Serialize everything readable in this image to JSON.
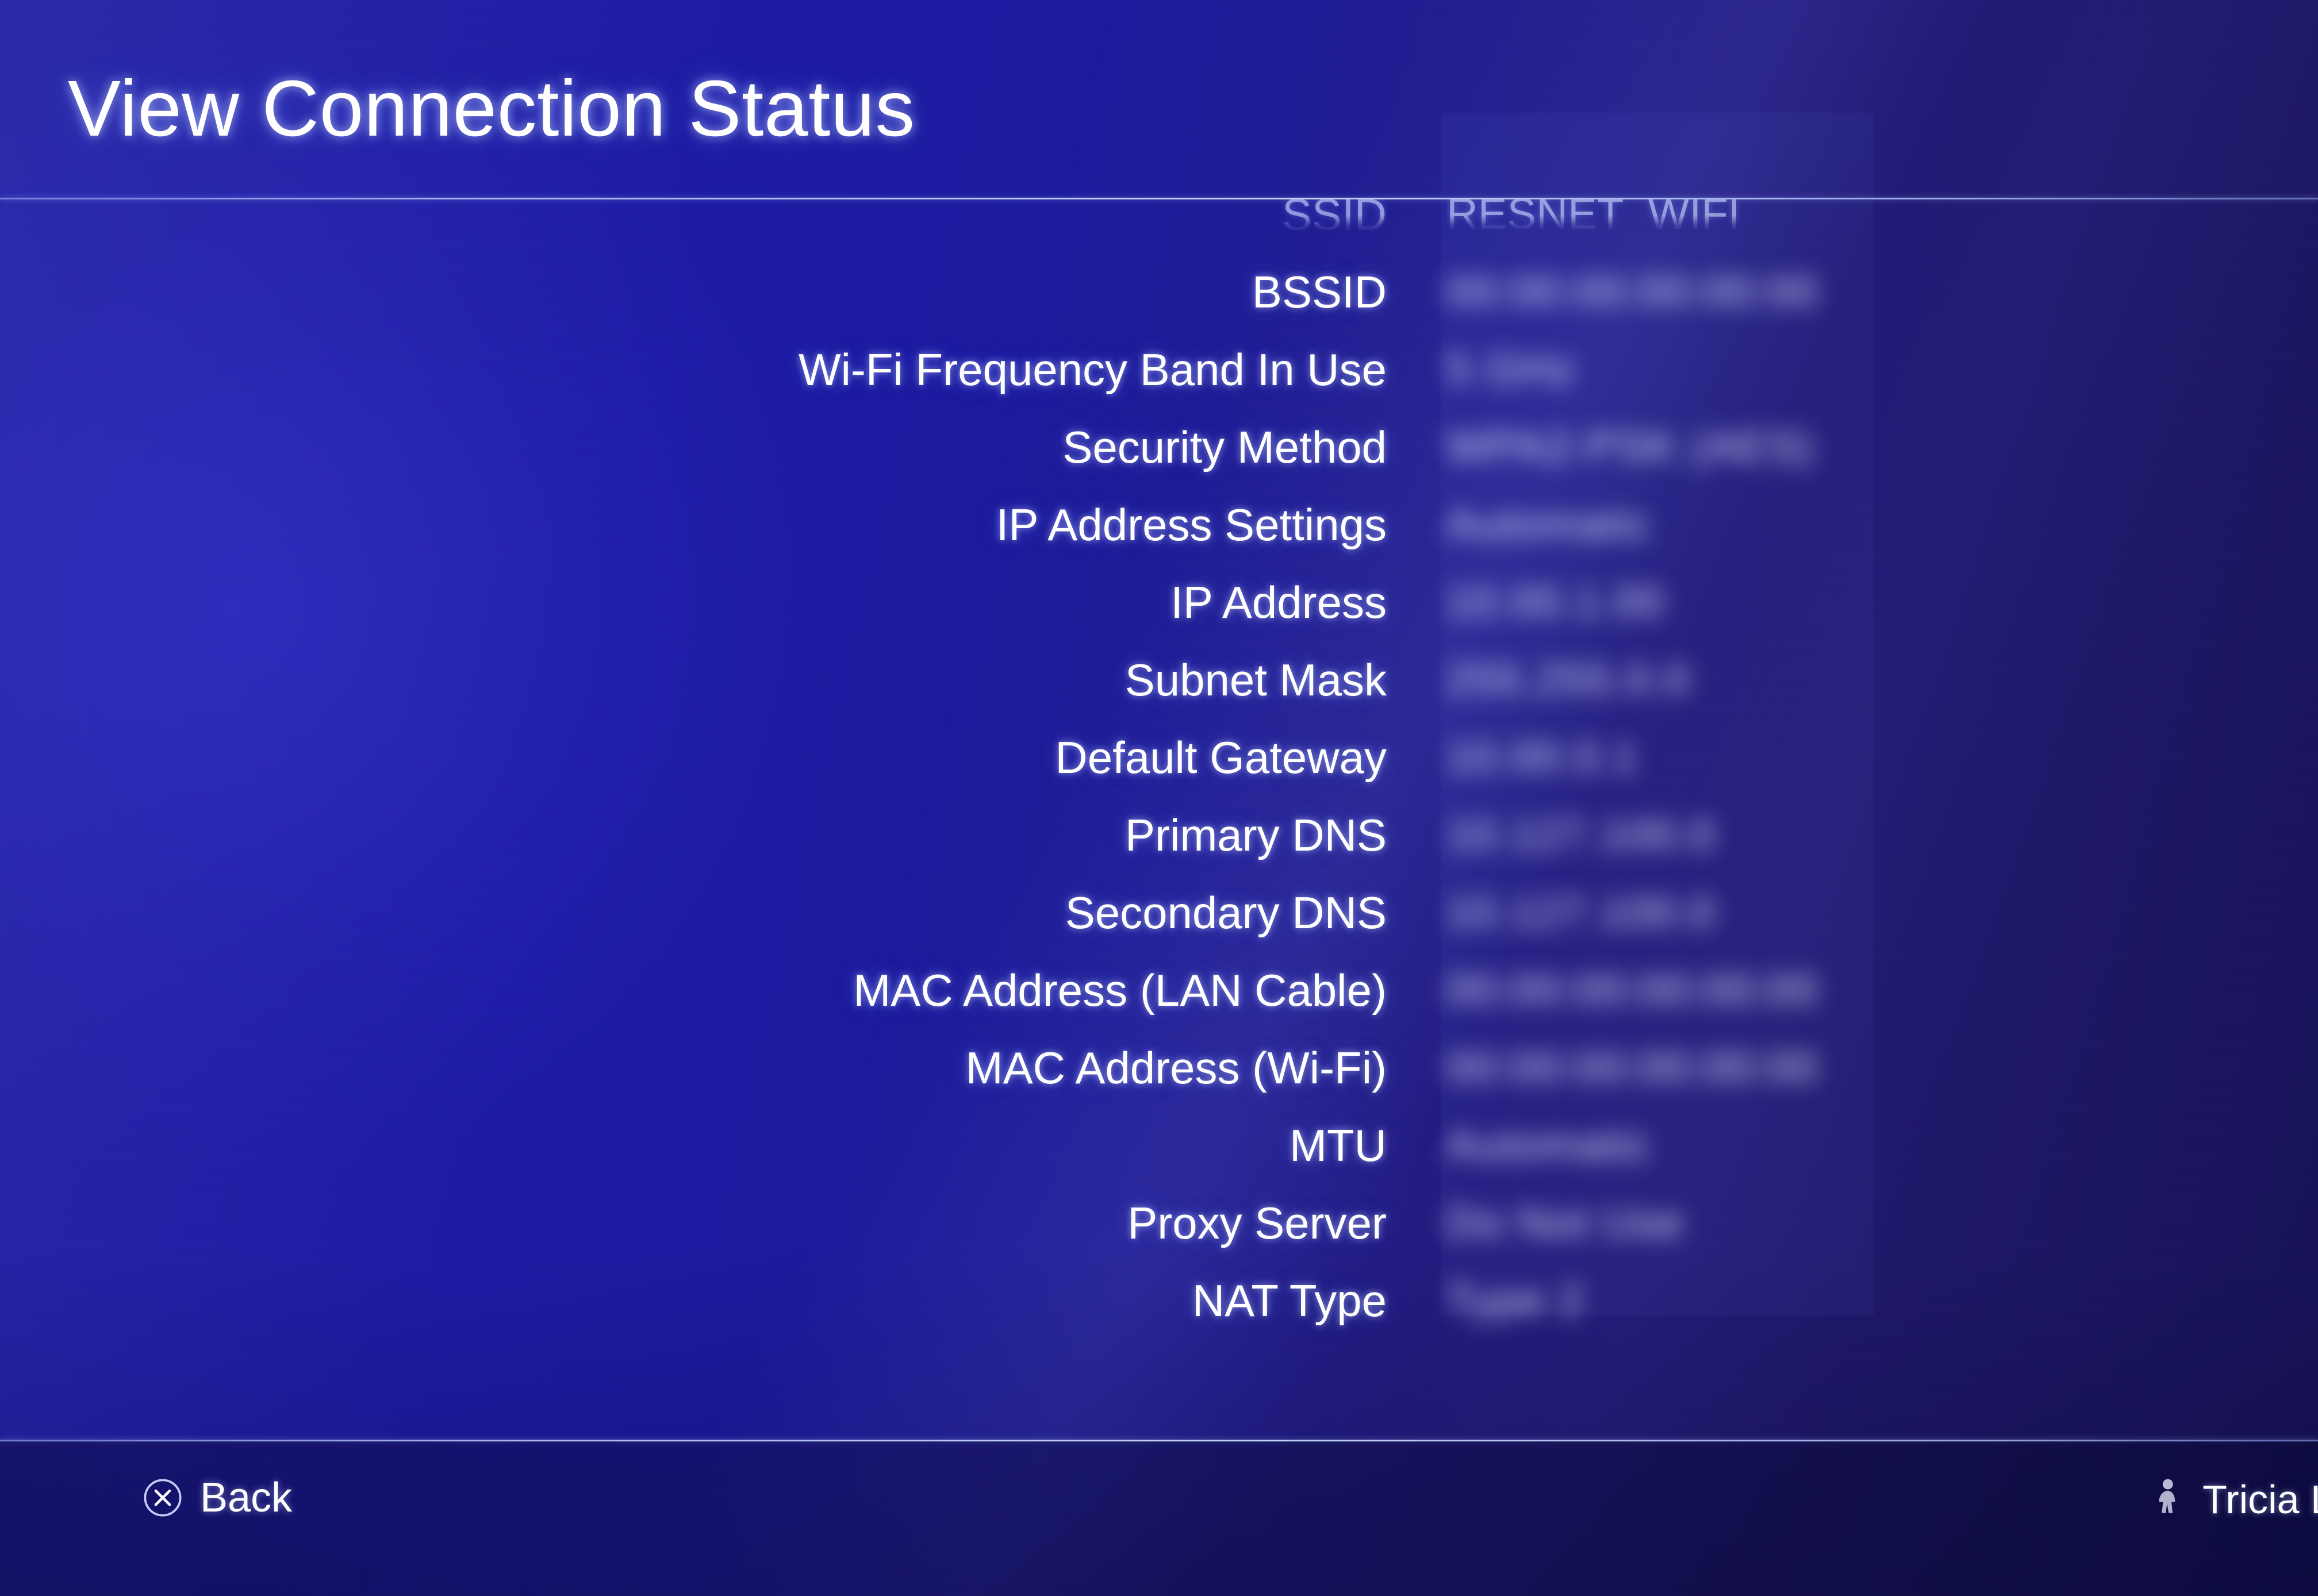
{
  "header": {
    "title": "View Connection Status"
  },
  "connection": {
    "rows": [
      {
        "label": "SSID",
        "value": "RESNET_WIFI",
        "redacted": false,
        "clipped": true
      },
      {
        "label": "BSSID",
        "value": "00:00:00:00:00:00",
        "redacted": true,
        "clipped": false
      },
      {
        "label": "Wi-Fi Frequency Band In Use",
        "value": "5 GHz",
        "redacted": true,
        "clipped": false
      },
      {
        "label": "Security Method",
        "value": "WPA2-PSK (AES)",
        "redacted": true,
        "clipped": false
      },
      {
        "label": "IP Address Settings",
        "value": "Automatic",
        "redacted": true,
        "clipped": false
      },
      {
        "label": "IP Address",
        "value": "10.00.1.00",
        "redacted": true,
        "clipped": false
      },
      {
        "label": "Subnet Mask",
        "value": "255.255.0.0",
        "redacted": true,
        "clipped": false
      },
      {
        "label": "Default Gateway",
        "value": "10.00.0.1",
        "redacted": true,
        "clipped": false
      },
      {
        "label": "Primary DNS",
        "value": "10.127.100.0",
        "redacted": true,
        "clipped": false
      },
      {
        "label": "Secondary DNS",
        "value": "10.127.100.0",
        "redacted": true,
        "clipped": false
      },
      {
        "label": "MAC Address (LAN Cable)",
        "value": "00:00:00:00:00:00",
        "redacted": true,
        "clipped": false
      },
      {
        "label": "MAC Address (Wi-Fi)",
        "value": "00:00:00:00:00:00",
        "redacted": true,
        "clipped": false
      },
      {
        "label": "MTU",
        "value": "Automatic",
        "redacted": true,
        "clipped": false
      },
      {
        "label": "Proxy Server",
        "value": "Do Not Use",
        "redacted": true,
        "clipped": false
      },
      {
        "label": "NAT Type",
        "value": "Type 2",
        "redacted": true,
        "clipped": false
      }
    ]
  },
  "footer": {
    "back_label": "Back",
    "back_icon": "cross-button-icon",
    "user_name": "Tricia L",
    "avatar_icon": "user-avatar-icon"
  },
  "colors": {
    "background_left": "#2a29a0",
    "background_center": "#1a18a8",
    "background_right": "#201a72",
    "footer": "#1c1c66",
    "divider": "#b9c8ff",
    "text": "#ffffff"
  }
}
